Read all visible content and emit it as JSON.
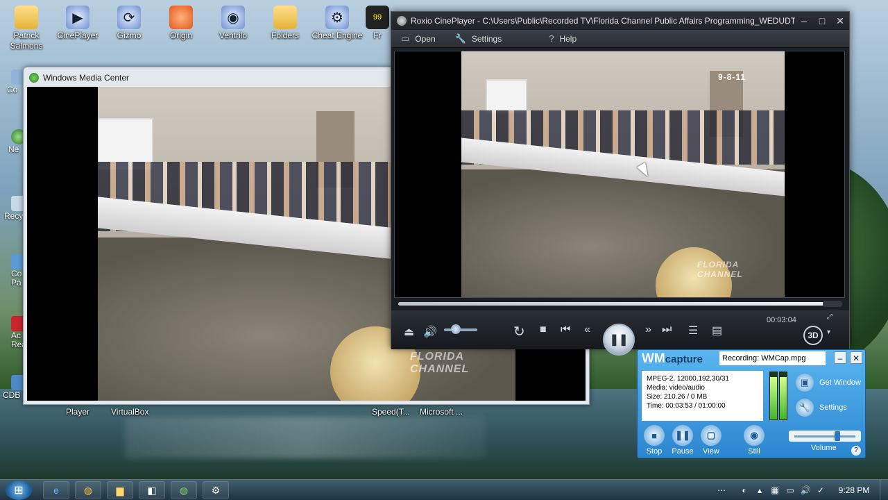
{
  "desktop": {
    "icons": [
      {
        "label": "Patrick Salmons",
        "icon": "folder-icon"
      },
      {
        "label": "CinePlayer",
        "icon": "cineplayer-icon"
      },
      {
        "label": "Gizmo",
        "icon": "gizmo-icon"
      },
      {
        "label": "Origin",
        "icon": "origin-icon"
      },
      {
        "label": "Ventrilo",
        "icon": "ventrilo-icon"
      },
      {
        "label": "Folders",
        "icon": "folder-icon"
      },
      {
        "label": "Cheat Engine",
        "icon": "cheat-engine-icon"
      },
      {
        "label": "Fr",
        "icon": "fraps-icon"
      }
    ],
    "left_edge_labels": [
      "Co",
      "Ne",
      "Recy",
      "Co\nPa",
      "Ac\nRea",
      "CDB"
    ],
    "under_labels": [
      "Player",
      "VirtualBox",
      "Speed(T...",
      "Microsoft ..."
    ]
  },
  "wmc": {
    "title": "Windows Media Center",
    "watermark": "FLORIDA CHANNEL"
  },
  "cineplayer": {
    "title": "Roxio CinePlayer - C:\\Users\\Public\\Recorded TV\\Florida Channel Public Affairs Programming_WEDUDT3_2011_0...",
    "menu": [
      {
        "label": "Open",
        "icon": "open-icon"
      },
      {
        "label": "Settings",
        "icon": "wrench-icon"
      },
      {
        "label": "Help",
        "icon": "help-icon"
      }
    ],
    "video_date_overlay": "9-8-11",
    "watermark": "FLORIDA CHANNEL",
    "time": "00:03:04",
    "btn_3d": "3D",
    "progress": 0.97,
    "volume": 0.25
  },
  "wmcapture": {
    "logo_wm": "WM",
    "logo_capture": "capture",
    "recording": "Recording: WMCap.mpg",
    "info": [
      "MPEG-2, 12000,192,30/31",
      "Media: video/audio",
      "Size: 210.26 / 0 MB",
      "Time: 00:03:53 / 01:00:00"
    ],
    "get_window": "Get Window",
    "settings": "Settings",
    "buttons": [
      "Stop",
      "Pause",
      "View",
      "Still"
    ],
    "volume_label": "Volume",
    "volume": 0.7,
    "meters": [
      0.9,
      0.9
    ]
  },
  "taskbar": {
    "items": [
      "ie-icon",
      "chrome-icon",
      "explorer-icon",
      "app-icon",
      "chrome-icon",
      "app2-icon"
    ],
    "clock": "9:28 PM"
  }
}
